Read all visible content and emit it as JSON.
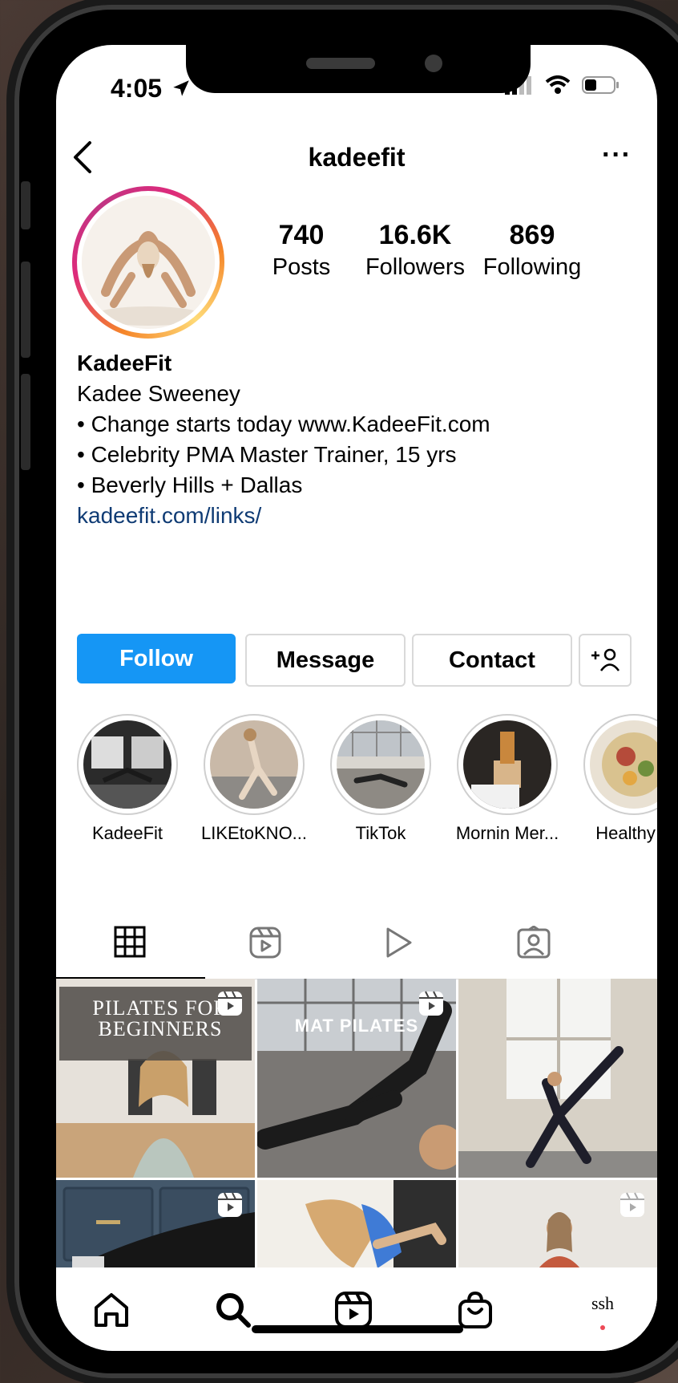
{
  "status_bar": {
    "time": "4:05"
  },
  "header": {
    "username": "kadeefit",
    "more": "···"
  },
  "profile": {
    "stats": [
      {
        "value": "740",
        "label": "Posts"
      },
      {
        "value": "16.6K",
        "label": "Followers"
      },
      {
        "value": "869",
        "label": "Following"
      }
    ],
    "display_name": "KadeeFit",
    "bio_lines": [
      "Kadee Sweeney",
      "• Change starts today www.KadeeFit.com",
      "• Celebrity PMA Master Trainer, 15 yrs",
      "• Beverly Hills + Dallas"
    ],
    "link": "kadeefit.com/links/"
  },
  "actions": {
    "follow": "Follow",
    "message": "Message",
    "contact": "Contact"
  },
  "highlights": [
    {
      "label": "KadeeFit"
    },
    {
      "label": "LIKEtoKNO..."
    },
    {
      "label": "TikTok"
    },
    {
      "label": "Mornin Mer..."
    },
    {
      "label": "Healthy E"
    }
  ],
  "tabs": [
    "grid-icon",
    "reels-icon",
    "video-play-icon",
    "tagged-icon"
  ],
  "posts": [
    {
      "overlay": "PILATES FOR\nBEGINNERS",
      "reel": true
    },
    {
      "overlay": "MAT PILATES",
      "reel": true
    },
    {
      "overlay": "",
      "reel": false
    },
    {
      "overlay": "",
      "reel": true
    },
    {
      "overlay": "",
      "reel": false
    },
    {
      "overlay": "",
      "reel": true
    }
  ],
  "bottom_nav": {
    "profile_label": "ssh"
  },
  "colors": {
    "follow_button": "#1596f5",
    "link": "#0f3b74",
    "story_ring": "#dd2a7b"
  }
}
